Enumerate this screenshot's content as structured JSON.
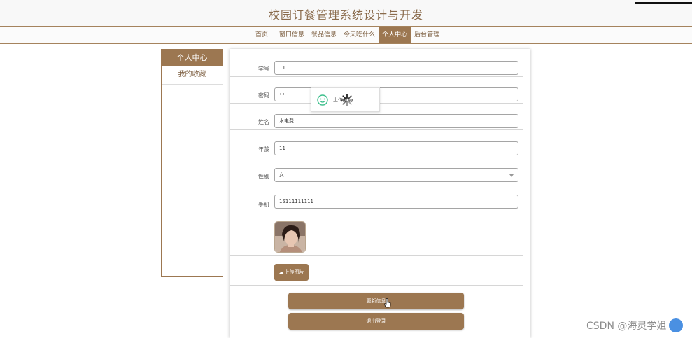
{
  "header": {
    "title": "校园订餐管理系统设计与开发"
  },
  "nav": {
    "items": [
      {
        "label": "首页",
        "active": false
      },
      {
        "label": "窗口信息",
        "active": false
      },
      {
        "label": "餐品信息",
        "active": false
      },
      {
        "label": "今天吃什么",
        "active": false
      },
      {
        "label": "个人中心",
        "active": true
      },
      {
        "label": "后台管理",
        "active": false
      }
    ]
  },
  "sidebar": {
    "title": "个人中心",
    "items": [
      {
        "label": "我的收藏"
      }
    ]
  },
  "form": {
    "student_id": {
      "label": "学号",
      "value": "11"
    },
    "password": {
      "label": "密码",
      "value": "••"
    },
    "name": {
      "label": "姓名",
      "value": "水电费"
    },
    "age": {
      "label": "年龄",
      "value": "11"
    },
    "gender": {
      "label": "性别",
      "value": "女"
    },
    "phone": {
      "label": "手机",
      "value": "15111111111"
    },
    "upload_label": "上传图片",
    "update_label": "更新信息",
    "logout_label": "退出登录"
  },
  "toast": {
    "text": "上传成功"
  },
  "watermark": {
    "text": "CSDN @海灵学姐"
  },
  "colors": {
    "accent": "#9c7751",
    "accent_text": "#8a6b4c"
  }
}
